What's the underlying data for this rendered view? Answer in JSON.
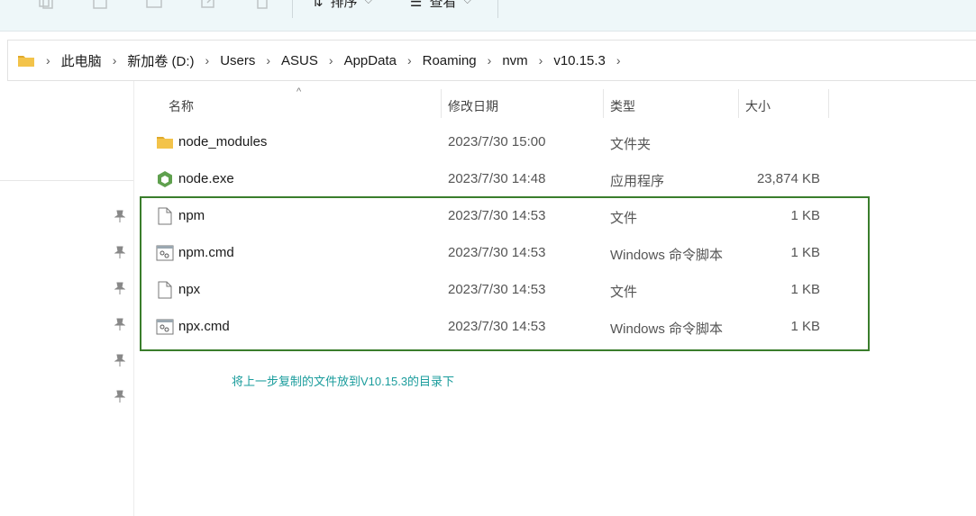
{
  "toolbar": {
    "sort_label": "排序",
    "view_label": "查看",
    "more_label": "···"
  },
  "breadcrumb": {
    "items": [
      "此电脑",
      "新加卷 (D:)",
      "Users",
      "ASUS",
      "AppData",
      "Roaming",
      "nvm",
      "v10.15.3"
    ]
  },
  "columns": {
    "name": "名称",
    "date": "修改日期",
    "type": "类型",
    "size": "大小"
  },
  "files": [
    {
      "name": "node_modules",
      "date": "2023/7/30 15:00",
      "type": "文件夹",
      "size": "",
      "icon": "folder-icon"
    },
    {
      "name": "node.exe",
      "date": "2023/7/30 14:48",
      "type": "应用程序",
      "size": "23,874 KB",
      "icon": "nodejs-icon"
    },
    {
      "name": "npm",
      "date": "2023/7/30 14:53",
      "type": "文件",
      "size": "1 KB",
      "icon": "file-icon"
    },
    {
      "name": "npm.cmd",
      "date": "2023/7/30 14:53",
      "type": "Windows 命令脚本",
      "size": "1 KB",
      "icon": "cmd-script-icon"
    },
    {
      "name": "npx",
      "date": "2023/7/30 14:53",
      "type": "文件",
      "size": "1 KB",
      "icon": "file-icon"
    },
    {
      "name": "npx.cmd",
      "date": "2023/7/30 14:53",
      "type": "Windows 命令脚本",
      "size": "1 KB",
      "icon": "cmd-script-icon"
    }
  ],
  "annotation": "将上一步复制的文件放到V10.15.3的目录下",
  "colors": {
    "highlight_border": "#3a7d2c",
    "annotation_text": "#1a9c9c",
    "folder": "#f3c34a",
    "toolbar_bg": "#eef7f9"
  }
}
